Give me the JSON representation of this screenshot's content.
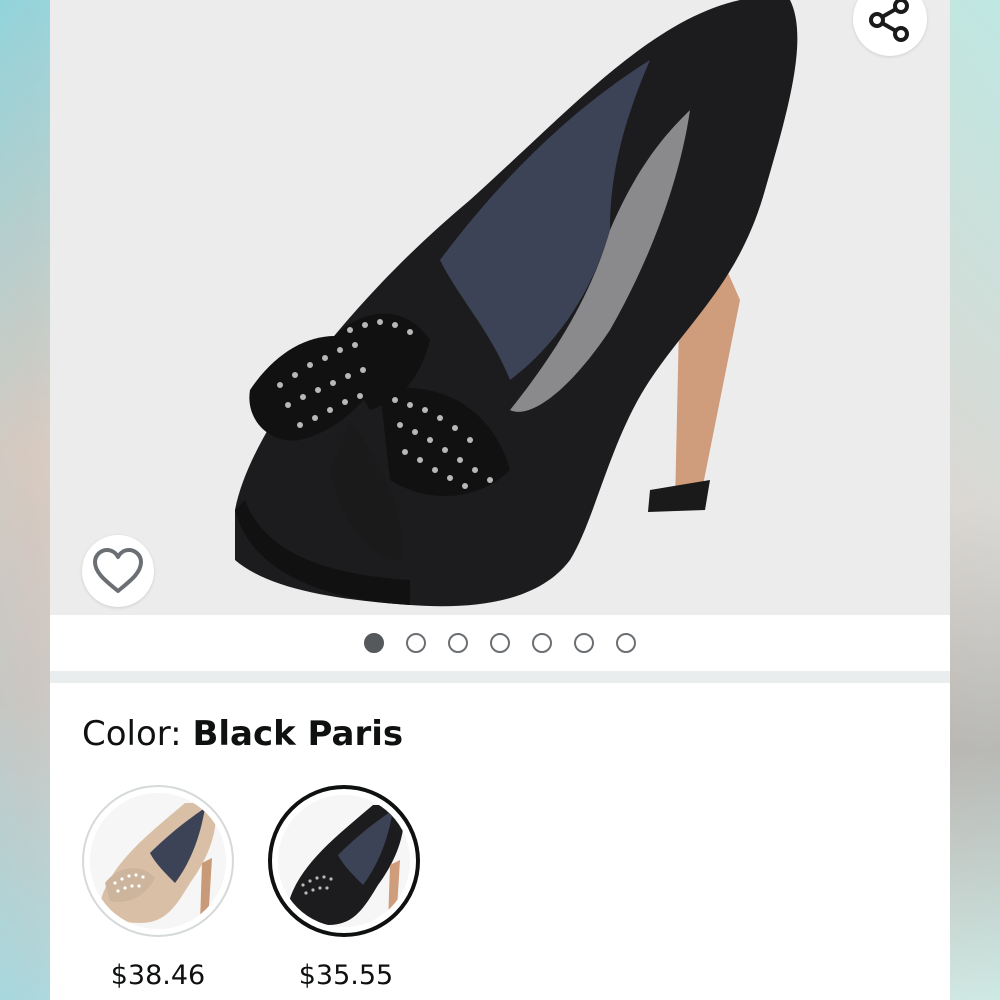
{
  "product": {
    "color_label_prefix": "Color: ",
    "color_value": "Black Paris"
  },
  "carousel": {
    "image_count": 7,
    "active_index": 0
  },
  "swatches": [
    {
      "price": "$38.46",
      "selected": false,
      "tone": "#d9bfa6"
    },
    {
      "price": "$35.55",
      "selected": true,
      "tone": "#1c1c1e"
    }
  ],
  "icons": {
    "share": "share-icon",
    "wishlist": "heart-icon"
  },
  "colors": {
    "active_dot": "#56595c",
    "selected_swatch_border": "#0f1111"
  }
}
